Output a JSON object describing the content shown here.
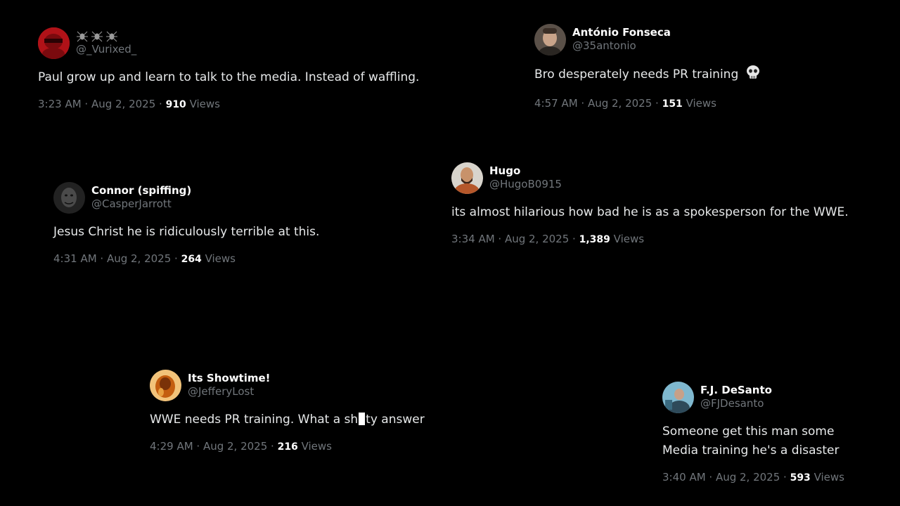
{
  "tweets": [
    {
      "display_name": "🕷🕷🕷",
      "handle": "@_Vurixed_",
      "text": "Paul grow up and learn to talk to the media. Instead of waffling.",
      "time": "3:23 AM · Aug 2, 2025 · ",
      "views_count": "910",
      "views_label": " Views",
      "avatar_color": "#c4161c"
    },
    {
      "display_name": "António Fonseca",
      "handle": "@35antonio",
      "text": "Bro desperately needs PR training",
      "emoji_icon": "skull-icon",
      "time": "4:57 AM · Aug 2, 2025 · ",
      "views_count": "151",
      "views_label": " Views",
      "avatar_color": "#8a7a6a"
    },
    {
      "display_name": "Connor (spiffing)",
      "handle": "@CasperJarrott",
      "text": "Jesus Christ he is ridiculously terrible at this.",
      "time": "4:31 AM · Aug 2, 2025 · ",
      "views_count": "264",
      "views_label": " Views",
      "avatar_color": "#3a3a3a"
    },
    {
      "display_name": "Hugo",
      "handle": "@HugoB0915",
      "text": "its almost hilarious how bad he is as a spokesperson for the WWE.",
      "time": "3:34 AM · Aug 2, 2025 · ",
      "views_count": "1,389",
      "views_label": " Views",
      "avatar_color": "#b5572a"
    },
    {
      "display_name": "Its Showtime!",
      "handle": "@JefferyLost",
      "text_before": "WWE needs PR training. What a sh",
      "text_after": "ty answer",
      "time": "4:29 AM · Aug 2, 2025 · ",
      "views_count": "216",
      "views_label": " Views",
      "avatar_color": "#e08a1e"
    },
    {
      "display_name": "F.J. DeSanto",
      "handle": "@FJDesanto",
      "text_line1": "Someone get this man some",
      "text_line2": "Media training he's a disaster",
      "time": "3:40 AM · Aug 2, 2025 · ",
      "views_count": "593",
      "views_label": " Views",
      "avatar_color": "#4a8aa8"
    }
  ]
}
